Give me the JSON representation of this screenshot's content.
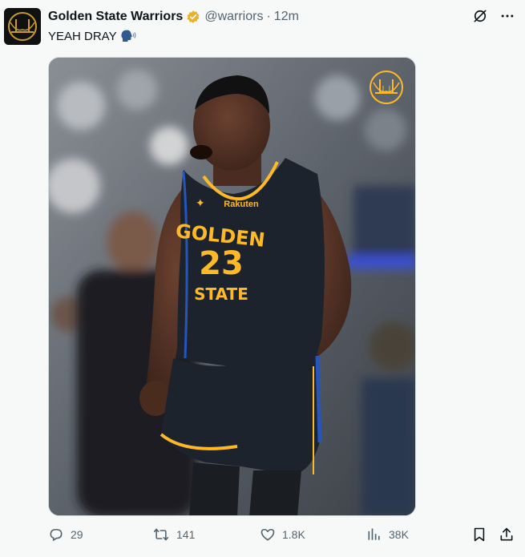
{
  "author": {
    "display_name": "Golden State Warriors",
    "handle": "@warriors",
    "separator": "·",
    "time": "12m",
    "verified_color": "#e8b32b",
    "avatar_icon": "warriors-bridge-logo-icon"
  },
  "tweet": {
    "text": "YEAH DRAY",
    "emoji_icon": "speaking-head-icon"
  },
  "media": {
    "jersey_line1": "GOLDEN",
    "jersey_number": "23",
    "jersey_line2": "STATE",
    "jersey_sponsor": "Rakuten",
    "logo_icon": "warriors-bridge-logo-icon"
  },
  "actions": {
    "replies": "29",
    "retweets": "141",
    "likes": "1.8K",
    "views": "38K"
  },
  "colors": {
    "text": "#0f1419",
    "muted": "#536471",
    "accent_gold": "#fdb927",
    "jersey": "#1d232d"
  }
}
